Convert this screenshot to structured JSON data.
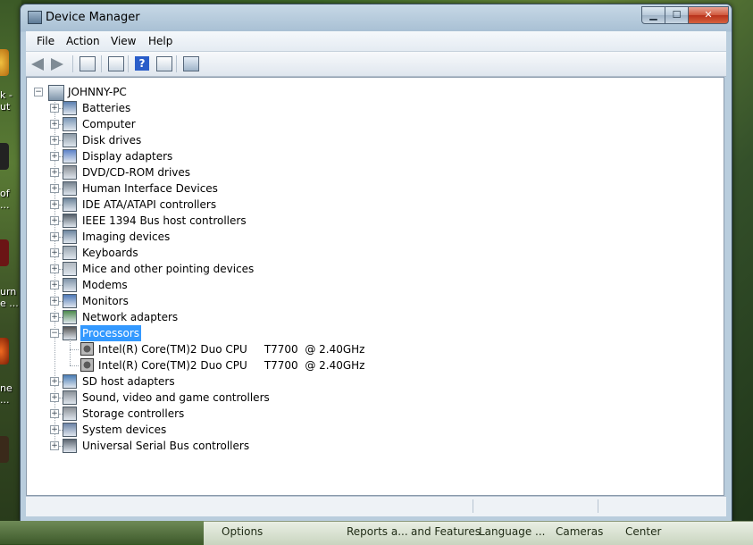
{
  "window": {
    "title": "Device Manager",
    "buttons": {
      "minimize": "▁",
      "maximize": "☐",
      "close": "✕"
    }
  },
  "menu": [
    "File",
    "Action",
    "View",
    "Help"
  ],
  "toolbar": {
    "icons": [
      "back-arrow-icon",
      "forward-arrow-icon",
      "show-hide-console-tree-icon",
      "properties-icon",
      "help-icon",
      "show-action-pane-icon",
      "scan-hardware-icon"
    ],
    "help_glyph": "?"
  },
  "tree": {
    "root": "JOHNNY-PC",
    "categories": [
      "Batteries",
      "Computer",
      "Disk drives",
      "Display adapters",
      "DVD/CD-ROM drives",
      "Human Interface Devices",
      "IDE ATA/ATAPI controllers",
      "IEEE 1394 Bus host controllers",
      "Imaging devices",
      "Keyboards",
      "Mice and other pointing devices",
      "Modems",
      "Monitors",
      "Network adapters",
      "Processors",
      "SD host adapters",
      "Sound, video and game controllers",
      "Storage controllers",
      "System devices",
      "Universal Serial Bus controllers"
    ],
    "expanded_index": 14,
    "expanded_children": [
      "Intel(R) Core(TM)2 Duo CPU     T7700  @ 2.40GHz",
      "Intel(R) Core(TM)2 Duo CPU     T7700  @ 2.40GHz"
    ],
    "expander_closed": "+",
    "expander_open": "−"
  },
  "desktop": {
    "labels": [
      "k -\nut",
      "of\n...",
      "urn\ne ...",
      "ne\n..."
    ]
  },
  "taskbar": {
    "items": [
      "Options",
      "Reports a...",
      "and Features",
      "Language ...",
      "Cameras",
      "Center"
    ]
  }
}
